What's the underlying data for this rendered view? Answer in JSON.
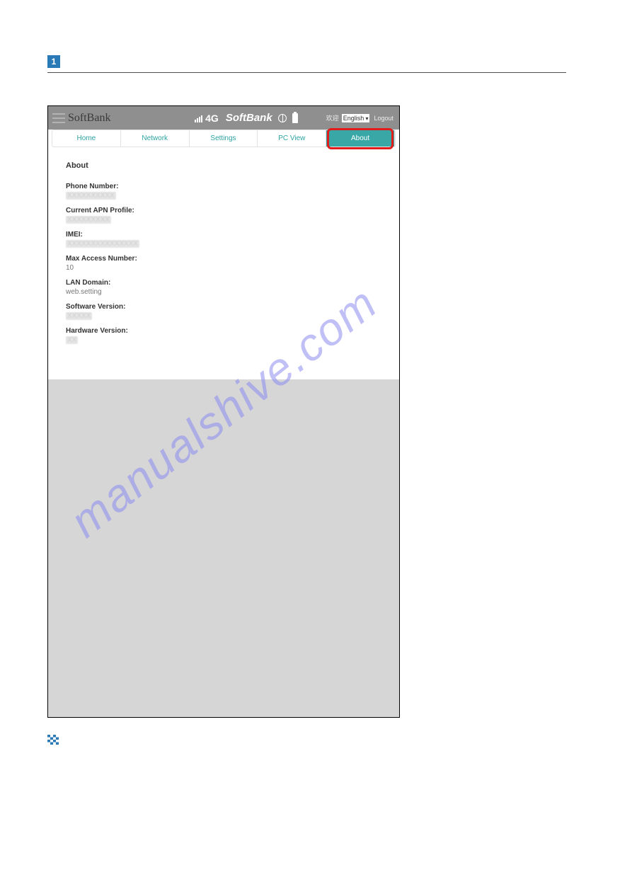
{
  "step": "1",
  "topbar": {
    "brand_left": "SoftBank",
    "network": "4G",
    "brand_center": "SoftBank",
    "greeting": "欢迎",
    "language": "English",
    "logout": "Logout"
  },
  "tabs": {
    "home": "Home",
    "network": "Network",
    "settings": "Settings",
    "pcview": "PC View",
    "about": "About"
  },
  "card": {
    "title": "About",
    "fields": {
      "phone_label": "Phone Number:",
      "phone_value": "XXXXXXXXXX",
      "apn_label": "Current APN Profile:",
      "apn_value": "XXXXXXXXX",
      "imei_label": "IMEI:",
      "imei_value": "XXXXXXXXXXXXXXX",
      "max_label": "Max Access Number:",
      "max_value": "10",
      "lan_label": "LAN Domain:",
      "lan_value": "web.setting",
      "soft_label": "Software Version:",
      "soft_value": "XXXXX",
      "hard_label": "Hardware Version:",
      "hard_value": "XX"
    }
  },
  "watermark": "manualshive.com"
}
